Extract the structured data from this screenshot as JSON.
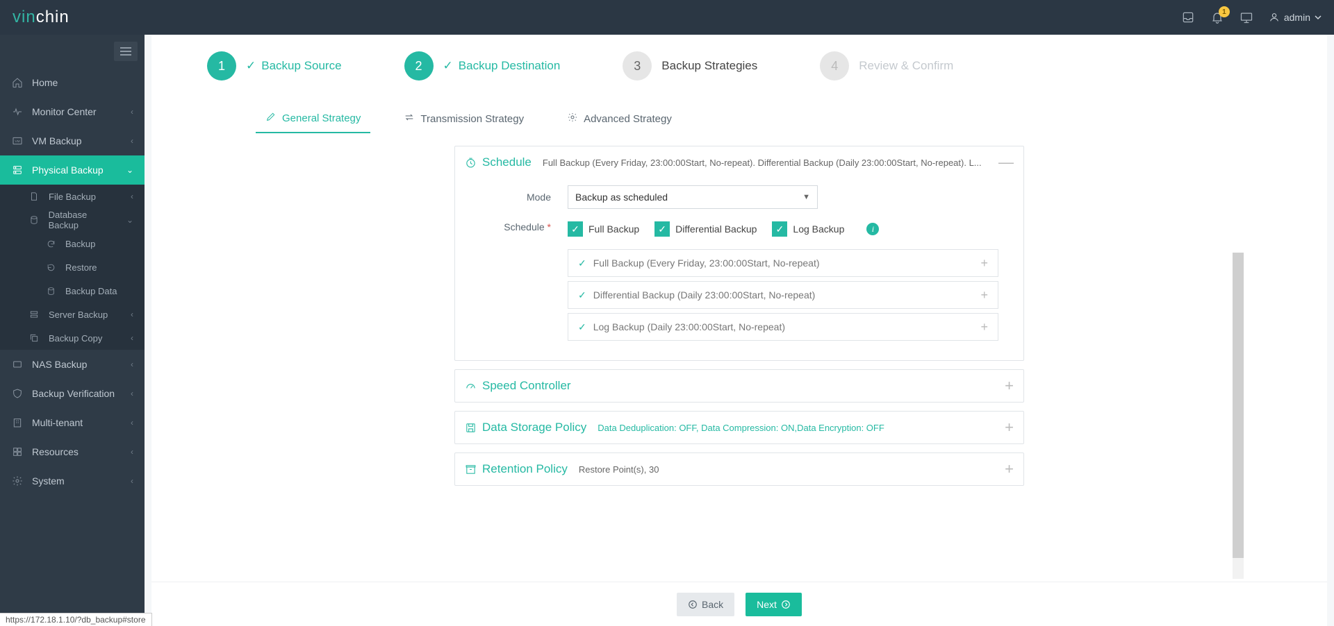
{
  "brand": {
    "part1": "vin",
    "part2": "chin"
  },
  "topbar": {
    "notif_count": "1",
    "user": "admin"
  },
  "sidebar": {
    "home": "Home",
    "monitor": "Monitor Center",
    "vm": "VM Backup",
    "physical": "Physical Backup",
    "file_backup": "File Backup",
    "db_backup": "Database Backup",
    "backup": "Backup",
    "restore": "Restore",
    "backup_data": "Backup Data",
    "server_backup": "Server Backup",
    "backup_copy": "Backup Copy",
    "nas": "NAS Backup",
    "verify": "Backup Verification",
    "multi": "Multi-tenant",
    "resources": "Resources",
    "system": "System"
  },
  "steps": {
    "s1": "Backup Source",
    "s2": "Backup Destination",
    "s3": "Backup Strategies",
    "s4": "Review & Confirm"
  },
  "tabs": {
    "general": "General Strategy",
    "trans": "Transmission Strategy",
    "adv": "Advanced Strategy"
  },
  "schedule": {
    "title": "Schedule",
    "desc": "Full Backup (Every Friday, 23:00:00Start, No-repeat). Differential Backup (Daily 23:00:00Start, No-repeat). L...",
    "mode_label": "Mode",
    "mode_value": "Backup as scheduled",
    "schedule_label": "Schedule",
    "full": "Full Backup",
    "diff": "Differential Backup",
    "log": "Log Backup",
    "row_full": "Full Backup (Every Friday, 23:00:00Start, No-repeat)",
    "row_diff": "Differential Backup (Daily 23:00:00Start, No-repeat)",
    "row_log": "Log Backup (Daily 23:00:00Start, No-repeat)"
  },
  "speed": {
    "title": "Speed Controller"
  },
  "storage": {
    "title": "Data Storage Policy",
    "desc": "Data Deduplication: OFF, Data Compression: ON,Data Encryption: OFF"
  },
  "retention": {
    "title": "Retention Policy",
    "desc": "Restore Point(s), 30"
  },
  "buttons": {
    "back": "Back",
    "next": "Next"
  },
  "status_url": "https://172.18.1.10/?db_backup#store"
}
